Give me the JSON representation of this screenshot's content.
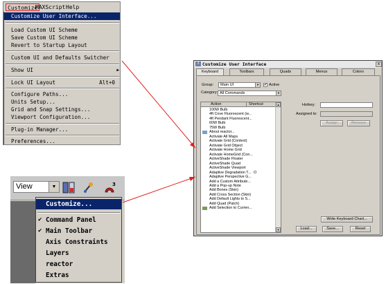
{
  "menubar": {
    "customize": "Customize",
    "maxscript": "MAXScript",
    "help": "Help"
  },
  "customize_menu": {
    "items": [
      {
        "label": "Customize User Interface...",
        "shortcut": "",
        "selected": true
      },
      {
        "label": "Load Custom UI Scheme",
        "shortcut": ""
      },
      {
        "label": "Save Custom UI Scheme",
        "shortcut": ""
      },
      {
        "label": "Revert to Startup Layout",
        "shortcut": ""
      },
      {
        "label": "Custom UI and Defaults Switcher",
        "shortcut": ""
      },
      {
        "label": "Show UI",
        "shortcut": "",
        "submenu": true
      },
      {
        "label": "Lock UI Layout",
        "shortcut": "Alt+0"
      },
      {
        "label": "Configure Paths...",
        "shortcut": ""
      },
      {
        "label": "Units Setup...",
        "shortcut": ""
      },
      {
        "label": "Grid and Snap Settings...",
        "shortcut": ""
      },
      {
        "label": "Viewport Configuration...",
        "shortcut": ""
      },
      {
        "label": "Plug-in Manager...",
        "shortcut": ""
      },
      {
        "label": "Preferences...",
        "shortcut": ""
      }
    ]
  },
  "toolbar": {
    "view_combo": "View"
  },
  "context_menu": {
    "items": [
      {
        "label": "Customize...",
        "selected": true,
        "checked": false
      },
      {
        "label": "Command Panel",
        "checked": true
      },
      {
        "label": "Main Toolbar",
        "checked": true
      },
      {
        "label": "Axis Constraints",
        "checked": false
      },
      {
        "label": "Layers",
        "checked": false
      },
      {
        "label": "reactor",
        "checked": false
      },
      {
        "label": "Extras",
        "checked": false
      }
    ],
    "check_glyph": "✔"
  },
  "dialog": {
    "title": "Customize User Interface",
    "close_glyph": "x",
    "tabs": [
      "Keyboard",
      "Toolbars",
      "Quads",
      "Menus",
      "Colors"
    ],
    "active_tab": "Keyboard",
    "group_label": "Group:",
    "group_value": "Main UI",
    "active_label": "Active",
    "active_checked": true,
    "category_label": "Category:",
    "category_value": "All Commands",
    "columns": {
      "action": "Action",
      "shortcut": "Shortcut"
    },
    "actions": [
      {
        "label": "100W Bulb",
        "shortcut": ""
      },
      {
        "label": "4ft Cove Fluorescent (w...",
        "shortcut": ""
      },
      {
        "label": "4ft Pendant Fluorescent...",
        "shortcut": ""
      },
      {
        "label": "60W Bulb",
        "shortcut": ""
      },
      {
        "label": "75W Bulb",
        "shortcut": ""
      },
      {
        "label": "About reactor...",
        "shortcut": "",
        "icon": "reactor-icon"
      },
      {
        "label": "Activate All Maps",
        "shortcut": ""
      },
      {
        "label": "Activate Grid (Context)",
        "shortcut": ""
      },
      {
        "label": "Activate Grid Object",
        "shortcut": ""
      },
      {
        "label": "Activate Home Grid",
        "shortcut": ""
      },
      {
        "label": "Activate HomeGrid (Con...",
        "shortcut": ""
      },
      {
        "label": "ActiveShade Floater",
        "shortcut": ""
      },
      {
        "label": "ActiveShade Quad",
        "shortcut": ""
      },
      {
        "label": "ActiveShade Viewport",
        "shortcut": ""
      },
      {
        "label": "Adaptive Degradation T...",
        "shortcut": "O"
      },
      {
        "label": "Adaptive Perspective G...",
        "shortcut": ""
      },
      {
        "label": "Add a Custom Attribute...",
        "shortcut": ""
      },
      {
        "label": "Add a Pop-up Note",
        "shortcut": ""
      },
      {
        "label": "Add Bones (Skin)",
        "shortcut": ""
      },
      {
        "label": "Add Cross Section (Skin)",
        "shortcut": ""
      },
      {
        "label": "Add Default Lights to S...",
        "shortcut": ""
      },
      {
        "label": "Add Quad (Patch)",
        "shortcut": ""
      },
      {
        "label": "Add Selection to Curren...",
        "shortcut": "",
        "icon": "add-selection-icon"
      }
    ],
    "hotkey_label": "Hotkey:",
    "assigned_to_label": "Assigned to:",
    "assign_button": "Assign",
    "remove_button": "Remove",
    "write_keyboard_chart_button": "Write Keyboard Chart...",
    "load_button": "Load...",
    "save_button": "Save...",
    "reset_button": "Reset"
  },
  "colors": {
    "selection_bg": "#0a246a",
    "dialog_bg": "#d4d0c8",
    "arrow": "#e02020"
  }
}
